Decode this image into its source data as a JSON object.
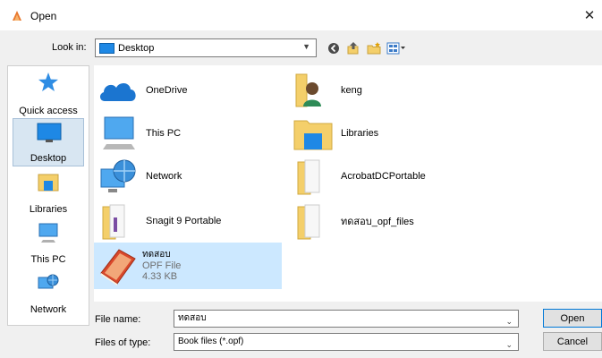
{
  "window": {
    "title": "Open",
    "close_symbol": "✕"
  },
  "toolbar": {
    "lookin_label": "Look in:",
    "lookin_value": "Desktop"
  },
  "places": [
    {
      "label": "Quick access",
      "icon": "star-icon"
    },
    {
      "label": "Desktop",
      "icon": "desktop-icon"
    },
    {
      "label": "Libraries",
      "icon": "libraries-icon"
    },
    {
      "label": "This PC",
      "icon": "computer-icon"
    },
    {
      "label": "Network",
      "icon": "network-icon"
    }
  ],
  "files": [
    {
      "name": "OneDrive",
      "icon": "onedrive-icon"
    },
    {
      "name": "keng",
      "icon": "user-folder-icon"
    },
    {
      "name": "This PC",
      "icon": "computer-icon"
    },
    {
      "name": "Libraries",
      "icon": "libraries-icon"
    },
    {
      "name": "Network",
      "icon": "network-icon"
    },
    {
      "name": "AcrobatDCPortable",
      "icon": "folder-icon"
    },
    {
      "name": "Snagit 9 Portable",
      "icon": "folder-icon"
    },
    {
      "name": "ทดสอบ_opf_files",
      "icon": "folder-icon"
    },
    {
      "name": "ทดสอบ",
      "type": "OPF File",
      "size": "4.33 KB",
      "icon": "book-icon"
    }
  ],
  "footer": {
    "filename_label": "File name:",
    "filename_value": "ทดสอบ",
    "filetype_label": "Files of type:",
    "filetype_value": "Book files (*.opf)",
    "open_label": "Open",
    "cancel_label": "Cancel"
  },
  "colors": {
    "selection": "#cce8ff",
    "accent": "#0078d7",
    "folder": "#f4cf6a"
  }
}
